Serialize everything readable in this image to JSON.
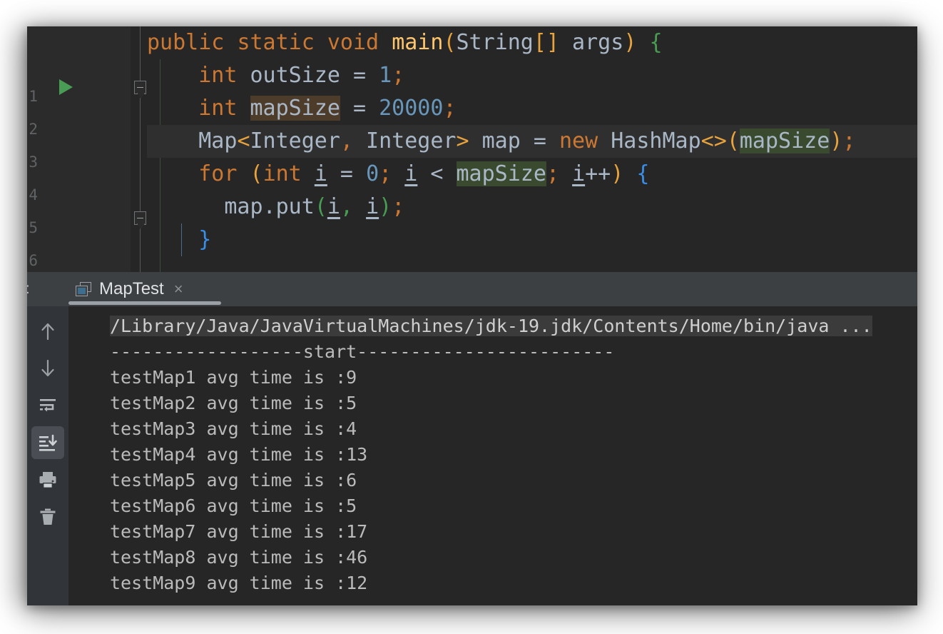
{
  "window": {
    "title": "MapTest"
  },
  "editor": {
    "gutter": {
      "run_arrow_tooltip": "Run",
      "line_numbers": [
        "",
        "1",
        "2",
        "3",
        "4",
        "5",
        "6"
      ],
      "fold_markers": [
        "collapse-method",
        "collapse-for",
        "collapse-end"
      ]
    },
    "lines": [
      {
        "id": "line-main-signature",
        "text": "public static void main(String[] args) {",
        "tokens": [
          {
            "t": "public",
            "c": "kw"
          },
          {
            "t": " ",
            "c": "id"
          },
          {
            "t": "static",
            "c": "kw"
          },
          {
            "t": " ",
            "c": "id"
          },
          {
            "t": "void",
            "c": "kw"
          },
          {
            "t": " ",
            "c": "id"
          },
          {
            "t": "main",
            "c": "mth"
          },
          {
            "t": "(",
            "c": "brc"
          },
          {
            "t": "String",
            "c": "id"
          },
          {
            "t": "[]",
            "c": "brc"
          },
          {
            "t": " args",
            "c": "id"
          },
          {
            "t": ")",
            "c": "brc"
          },
          {
            "t": " ",
            "c": "id"
          },
          {
            "t": "{",
            "c": "brc-g"
          }
        ]
      },
      {
        "id": "line-outsize",
        "text": "int outSize = 1;",
        "tokens": [
          {
            "t": "    ",
            "c": "id"
          },
          {
            "t": "int",
            "c": "kw"
          },
          {
            "t": " outSize ",
            "c": "id"
          },
          {
            "t": "=",
            "c": "id"
          },
          {
            "t": " ",
            "c": "id"
          },
          {
            "t": "1",
            "c": "num"
          },
          {
            "t": ";",
            "c": "kw"
          }
        ]
      },
      {
        "id": "line-mapsize",
        "text": "int mapSize = 20000;",
        "tokens": [
          {
            "t": "    ",
            "c": "id"
          },
          {
            "t": "int",
            "c": "kw"
          },
          {
            "t": " ",
            "c": "id"
          },
          {
            "t": "mapSize",
            "c": "id hl-w"
          },
          {
            "t": " ",
            "c": "id"
          },
          {
            "t": "=",
            "c": "id"
          },
          {
            "t": " ",
            "c": "id"
          },
          {
            "t": "20000",
            "c": "num"
          },
          {
            "t": ";",
            "c": "kw"
          }
        ]
      },
      {
        "id": "line-map-decl",
        "current": true,
        "text": "Map<Integer, Integer> map = new HashMap<>(mapSize);",
        "tokens": [
          {
            "t": "    ",
            "c": "id"
          },
          {
            "t": "Map",
            "c": "id"
          },
          {
            "t": "<",
            "c": "brc"
          },
          {
            "t": "Integer",
            "c": "id"
          },
          {
            "t": ",",
            "c": "kw"
          },
          {
            "t": " Integer",
            "c": "id"
          },
          {
            "t": ">",
            "c": "brc"
          },
          {
            "t": " map ",
            "c": "id"
          },
          {
            "t": "=",
            "c": "id"
          },
          {
            "t": " ",
            "c": "id"
          },
          {
            "t": "new",
            "c": "kw"
          },
          {
            "t": " HashMap",
            "c": "id"
          },
          {
            "t": "<>",
            "c": "brc"
          },
          {
            "t": "(",
            "c": "brc"
          },
          {
            "t": "mapSize",
            "c": "id hl-g"
          },
          {
            "t": ")",
            "c": "brc"
          },
          {
            "t": ";",
            "c": "kw"
          }
        ]
      },
      {
        "id": "line-for",
        "text": "for (int i = 0; i < mapSize; i++) {",
        "tokens": [
          {
            "t": "    ",
            "c": "id"
          },
          {
            "t": "for",
            "c": "kw"
          },
          {
            "t": " ",
            "c": "id"
          },
          {
            "t": "(",
            "c": "brc"
          },
          {
            "t": "int",
            "c": "kw"
          },
          {
            "t": " ",
            "c": "id"
          },
          {
            "t": "i",
            "c": "local"
          },
          {
            "t": " = ",
            "c": "id"
          },
          {
            "t": "0",
            "c": "num"
          },
          {
            "t": ";",
            "c": "kw"
          },
          {
            "t": " ",
            "c": "id"
          },
          {
            "t": "i",
            "c": "local"
          },
          {
            "t": " < ",
            "c": "id"
          },
          {
            "t": "mapSize",
            "c": "id hl-g"
          },
          {
            "t": ";",
            "c": "kw"
          },
          {
            "t": " ",
            "c": "id"
          },
          {
            "t": "i",
            "c": "local"
          },
          {
            "t": "++",
            "c": "id"
          },
          {
            "t": ")",
            "c": "brc"
          },
          {
            "t": " ",
            "c": "id"
          },
          {
            "t": "{",
            "c": "brc-b"
          }
        ]
      },
      {
        "id": "line-map-put",
        "text": "map.put(i, i);",
        "tokens": [
          {
            "t": "      ",
            "c": "id"
          },
          {
            "t": "map",
            "c": "id"
          },
          {
            "t": ".put",
            "c": "id"
          },
          {
            "t": "(",
            "c": "brc-g"
          },
          {
            "t": "i",
            "c": "local"
          },
          {
            "t": ",",
            "c": "brc-g"
          },
          {
            "t": " ",
            "c": "id"
          },
          {
            "t": "i",
            "c": "local"
          },
          {
            "t": ")",
            "c": "brc-g"
          },
          {
            "t": ";",
            "c": "kw"
          }
        ]
      },
      {
        "id": "line-for-close",
        "text": "}",
        "tokens": [
          {
            "t": "    ",
            "c": "id"
          },
          {
            "t": "}",
            "c": "brc-b"
          }
        ]
      }
    ]
  },
  "console": {
    "panel_label": "t:",
    "tab": {
      "icon": "run-configuration-icon",
      "label": "MapTest",
      "close_label": "×"
    },
    "toolbar": [
      {
        "name": "up-arrow-icon",
        "title": "Up the Stack Trace",
        "active": false
      },
      {
        "name": "down-arrow-icon",
        "title": "Down the Stack Trace",
        "active": false
      },
      {
        "name": "soft-wrap-icon",
        "title": "Soft-Wrap",
        "active": false
      },
      {
        "name": "scroll-to-end-icon",
        "title": "Scroll to End",
        "active": true
      },
      {
        "name": "print-icon",
        "title": "Print",
        "active": false
      },
      {
        "name": "trash-icon",
        "title": "Clear All",
        "active": false
      }
    ],
    "output": [
      {
        "text": "/Library/Java/JavaVirtualMachines/jdk-19.jdk/Contents/Home/bin/java ...",
        "highlight": true
      },
      {
        "text": "------------------start------------------------",
        "highlight": false
      },
      {
        "text": "testMap1 avg time is :9",
        "highlight": false
      },
      {
        "text": "testMap2 avg time is :5",
        "highlight": false
      },
      {
        "text": "testMap3 avg time is :4",
        "highlight": false
      },
      {
        "text": "testMap4 avg time is :13",
        "highlight": false
      },
      {
        "text": "testMap5 avg time is :6",
        "highlight": false
      },
      {
        "text": "testMap6 avg time is :5",
        "highlight": false
      },
      {
        "text": "testMap7 avg time is :17",
        "highlight": false
      },
      {
        "text": "testMap8 avg time is :46",
        "highlight": false
      },
      {
        "text": "testMap9 avg time is :12",
        "highlight": false
      }
    ]
  },
  "colors": {
    "editor_bg": "#262626",
    "gutter_bg": "#2b2b2b",
    "console_bg": "#262626",
    "console_header_bg": "#3c4043",
    "toolbar_bg": "#313438",
    "keyword": "#cc7832",
    "number": "#6897bb",
    "method": "#ffc66d",
    "identifier": "#a9b7c6",
    "bracket": "#e8a33d",
    "run_green": "#499c54",
    "output_text": "#bbbbbb",
    "accent_underline": "#9aa0a6"
  }
}
